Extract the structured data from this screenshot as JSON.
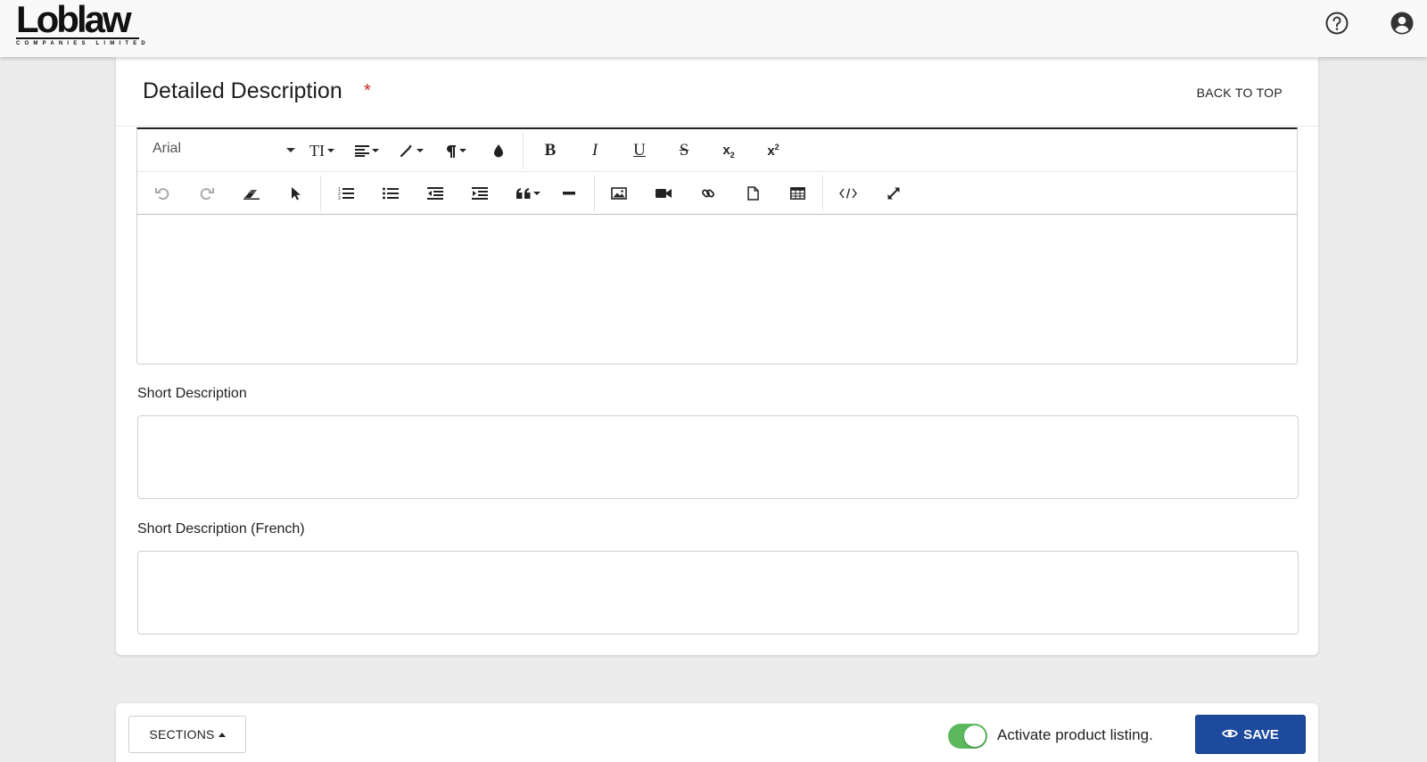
{
  "header": {
    "logo_text": "Loblaw",
    "logo_subtext": "COMPANIES LIMITED",
    "icons": [
      "help-circle-icon",
      "account-circle-icon"
    ]
  },
  "section": {
    "title": "Detailed Description",
    "required_marker": "*",
    "back_to_top": "BACK TO TOP"
  },
  "editor": {
    "font_family_value": "Arial",
    "toolbar_row1": [
      "font-size",
      "align",
      "style",
      "paragraph",
      "color",
      "bold",
      "italic",
      "underline",
      "strikethrough",
      "subscript",
      "superscript"
    ],
    "toolbar_row2": [
      "undo",
      "redo",
      "eraser",
      "select",
      "ordered-list",
      "unordered-list",
      "outdent",
      "indent",
      "blockquote",
      "horizontal-rule",
      "image",
      "video",
      "link",
      "file",
      "table",
      "code-view",
      "fullscreen"
    ],
    "bold_label": "B",
    "italic_label": "I",
    "underline_label": "U",
    "strike_label": "S",
    "sub_label": "x",
    "sub_small": "2",
    "sup_label": "x",
    "sup_small": "2",
    "fontsize_label": "TI",
    "content": ""
  },
  "short_description": {
    "label": "Short Description",
    "value": ""
  },
  "short_description_fr": {
    "label": "Short Description (French)",
    "value": ""
  },
  "footer": {
    "sections_label": "SECTIONS",
    "activate_label": "Activate product listing.",
    "activate_on": true,
    "save_label": "SAVE",
    "toggle_color": "#5cb85c",
    "save_color": "#1e4a9e"
  }
}
